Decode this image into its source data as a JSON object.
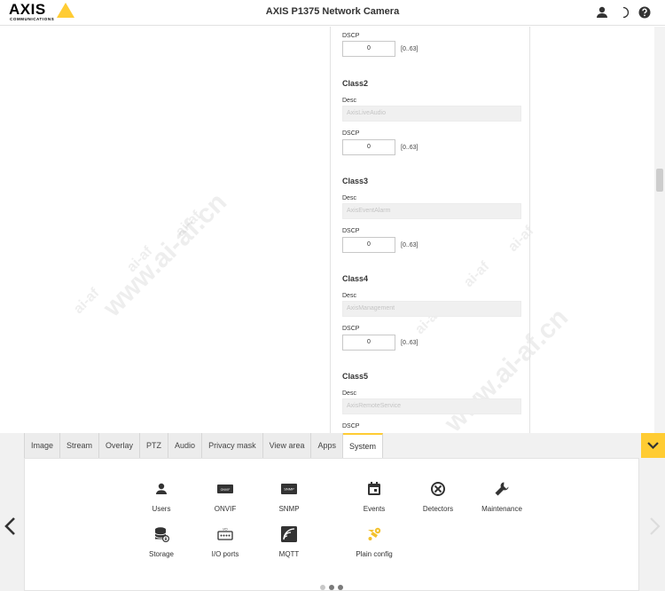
{
  "header": {
    "logo_text": "AXIS",
    "logo_sub": "COMMUNICATIONS",
    "title": "AXIS P1375 Network Camera",
    "icons": [
      "user-icon",
      "contrast-icon",
      "help-icon"
    ]
  },
  "qos": {
    "dscp_label": "DSCP",
    "desc_label": "Desc",
    "range": "[0..63]",
    "first_dscp_value": "0",
    "classes": [
      {
        "title": "Class2",
        "desc_placeholder": "AxisLiveAudio",
        "dscp": "0"
      },
      {
        "title": "Class3",
        "desc_placeholder": "AxisEventAlarm",
        "dscp": "0"
      },
      {
        "title": "Class4",
        "desc_placeholder": "AxisManagement",
        "dscp": "0"
      },
      {
        "title": "Class5",
        "desc_placeholder": "AxisRemoteService"
      }
    ]
  },
  "watermark": {
    "url": "www.ai-af.cn",
    "badge": "ai-af"
  },
  "tabs": [
    {
      "label": "Image"
    },
    {
      "label": "Stream"
    },
    {
      "label": "Overlay"
    },
    {
      "label": "PTZ"
    },
    {
      "label": "Audio"
    },
    {
      "label": "Privacy mask"
    },
    {
      "label": "View area"
    },
    {
      "label": "Apps"
    },
    {
      "label": "System",
      "active": true
    }
  ],
  "system_items": [
    {
      "label": "Users",
      "icon": "users-icon"
    },
    {
      "label": "ONVIF",
      "icon": "onvif-icon"
    },
    {
      "label": "SNMP",
      "icon": "snmp-icon"
    },
    {
      "label": "Events",
      "icon": "events-icon"
    },
    {
      "label": "Detectors",
      "icon": "detectors-icon"
    },
    {
      "label": "Maintenance",
      "icon": "maintenance-icon"
    },
    {
      "label": "Storage",
      "icon": "storage-icon"
    },
    {
      "label": "I/O ports",
      "icon": "io-ports-icon"
    },
    {
      "label": "MQTT",
      "icon": "mqtt-icon"
    },
    {
      "label": "Plain config",
      "icon": "plain-config-icon"
    }
  ],
  "icon_text": {
    "onvif": "ONVIF",
    "snmp": "SNMP",
    "io": "I/O"
  },
  "pager": {
    "count": 3,
    "active_index": 2
  },
  "colors": {
    "accent": "#ffcc33",
    "highlight_icon": "#f3c12c"
  }
}
